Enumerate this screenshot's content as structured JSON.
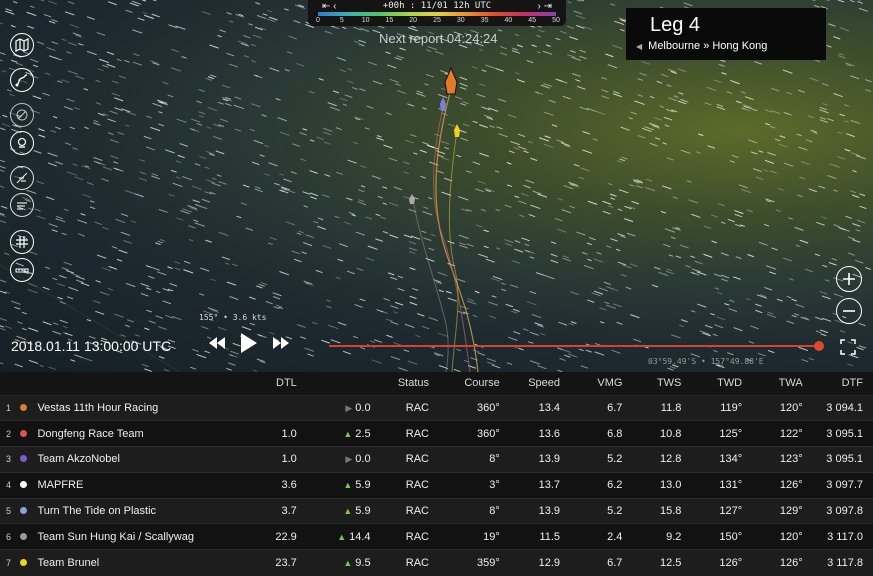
{
  "timeline": {
    "time_label": "+00h : 11/01 12h UTC",
    "scale_ticks": [
      "0",
      "5",
      "10",
      "15",
      "20",
      "25",
      "30",
      "35",
      "40",
      "45",
      "50"
    ]
  },
  "next_report": "Next report 04:24:24",
  "leg": {
    "title": "Leg 4",
    "route": "Melbourne » Hong Kong"
  },
  "wind_readout": "155° • 3.6 kts",
  "playback": {
    "date": "2018.01.11 13:00:00 UTC"
  },
  "coord_readout": "03°59.49'S • 157°49.88'E",
  "colors": {
    "progress": "#d8432c",
    "trend_up": "#7ac943",
    "trend_flat": "#777777"
  },
  "table": {
    "headers": {
      "dtl": "DTL",
      "status": "Status",
      "course": "Course",
      "speed": "Speed",
      "vmg": "VMG",
      "tws": "TWS",
      "twd": "TWD",
      "twa": "TWA",
      "dtf": "DTF"
    },
    "rows": [
      {
        "rank": "1",
        "color": "#e07b2a",
        "name": "Vestas 11th Hour Racing",
        "dtl": "",
        "trend": "flat",
        "change": "0.0",
        "status": "RAC",
        "course": "360°",
        "speed": "13.4",
        "vmg": "6.7",
        "tws": "11.8",
        "twd": "119°",
        "twa": "120°",
        "dtf": "3 094.1"
      },
      {
        "rank": "2",
        "color": "#d9544a",
        "name": "Dongfeng Race Team",
        "dtl": "1.0",
        "trend": "up",
        "change": "2.5",
        "status": "RAC",
        "course": "360°",
        "speed": "13.6",
        "vmg": "6.8",
        "tws": "10.8",
        "twd": "125°",
        "twa": "122°",
        "dtf": "3 095.1"
      },
      {
        "rank": "3",
        "color": "#7b5cc8",
        "name": "Team AkzoNobel",
        "dtl": "1.0",
        "trend": "flat",
        "change": "0.0",
        "status": "RAC",
        "course": "8°",
        "speed": "13.9",
        "vmg": "5.2",
        "tws": "12.8",
        "twd": "134°",
        "twa": "123°",
        "dtf": "3 095.1"
      },
      {
        "rank": "4",
        "color": "#ffffff",
        "name": "MAPFRE",
        "dtl": "3.6",
        "trend": "up",
        "change": "5.9",
        "status": "RAC",
        "course": "3°",
        "speed": "13.7",
        "vmg": "6.2",
        "tws": "13.0",
        "twd": "131°",
        "twa": "126°",
        "dtf": "3 097.7"
      },
      {
        "rank": "5",
        "color": "#8aa0e0",
        "name": "Turn The Tide on Plastic",
        "dtl": "3.7",
        "trend": "up",
        "change": "5.9",
        "status": "RAC",
        "course": "8°",
        "speed": "13.9",
        "vmg": "5.2",
        "tws": "15.8",
        "twd": "127°",
        "twa": "129°",
        "dtf": "3 097.8"
      },
      {
        "rank": "6",
        "color": "#9a9a9a",
        "name": "Team Sun Hung Kai / Scallywag",
        "dtl": "22.9",
        "trend": "up",
        "change": "14.4",
        "status": "RAC",
        "course": "19°",
        "speed": "11.5",
        "vmg": "2.4",
        "tws": "9.2",
        "twd": "150°",
        "twa": "120°",
        "dtf": "3 117.0"
      },
      {
        "rank": "7",
        "color": "#f0d020",
        "name": "Team Brunel",
        "dtl": "23.7",
        "trend": "up",
        "change": "9.5",
        "status": "RAC",
        "course": "359°",
        "speed": "12.9",
        "vmg": "6.7",
        "tws": "12.5",
        "twd": "126°",
        "twa": "126°",
        "dtf": "3 117.8"
      }
    ]
  },
  "icons": [
    "map-icon",
    "route-icon",
    "compass-icon",
    "boat-icon",
    "wind-icon",
    "layers-icon",
    "grid-icon",
    "ruler-icon",
    "zoom-in-icon",
    "zoom-out-icon",
    "fullscreen-icon"
  ]
}
